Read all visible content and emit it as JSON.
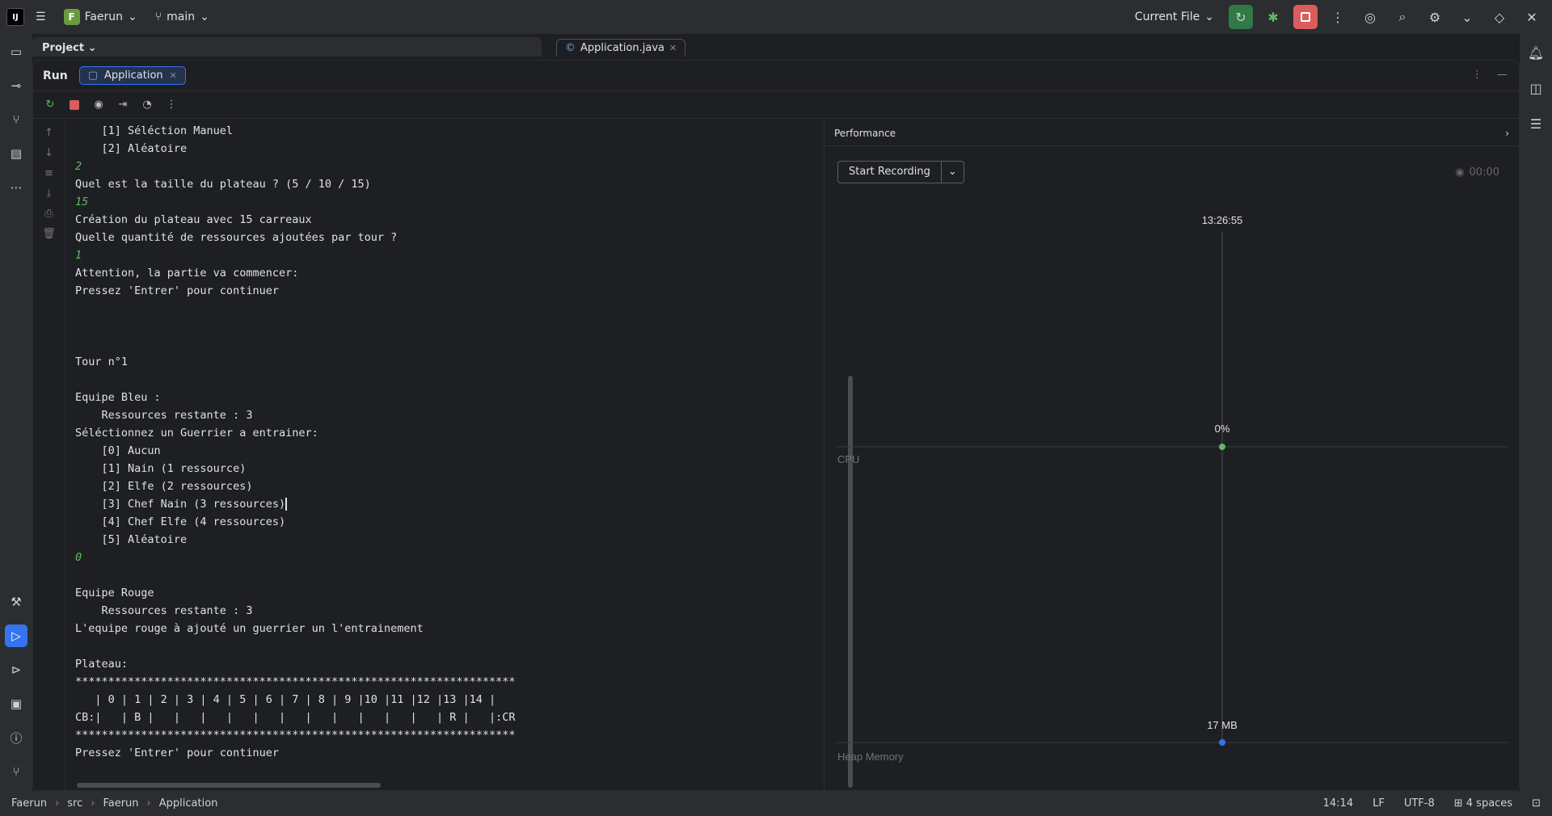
{
  "titlebar": {
    "logo": "IJ",
    "project_initial": "F",
    "project_name": "Faerun",
    "branch": "main",
    "run_config": "Current File"
  },
  "editor": {
    "project_label": "Project",
    "open_file": "Application.java"
  },
  "run": {
    "title": "Run",
    "tab_label": "Application"
  },
  "console": {
    "lines": [
      {
        "text": "    [1] Séléction Manuel",
        "input": false
      },
      {
        "text": "    [2] Aléatoire",
        "input": false
      },
      {
        "text": "2",
        "input": true
      },
      {
        "text": "Quel est la taille du plateau ? (5 / 10 / 15)",
        "input": false
      },
      {
        "text": "15",
        "input": true
      },
      {
        "text": "Création du plateau avec 15 carreaux",
        "input": false
      },
      {
        "text": "Quelle quantité de ressources ajoutées par tour ?",
        "input": false
      },
      {
        "text": "1",
        "input": true
      },
      {
        "text": "Attention, la partie va commencer:",
        "input": false
      },
      {
        "text": "Pressez 'Entrer' pour continuer",
        "input": false
      },
      {
        "text": "",
        "input": false
      },
      {
        "text": "",
        "input": false
      },
      {
        "text": "",
        "input": false
      },
      {
        "text": "Tour n°1",
        "input": false
      },
      {
        "text": "",
        "input": false
      },
      {
        "text": "Equipe Bleu :",
        "input": false
      },
      {
        "text": "    Ressources restante : 3",
        "input": false
      },
      {
        "text": "Séléctionnez un Guerrier a entrainer:",
        "input": false
      },
      {
        "text": "    [0] Aucun",
        "input": false
      },
      {
        "text": "    [1] Nain (1 ressource)",
        "input": false
      },
      {
        "text": "    [2] Elfe (2 ressources)",
        "input": false
      },
      {
        "text": "    [3] Chef Nain (3 ressources)",
        "input": false,
        "caret": true
      },
      {
        "text": "    [4] Chef Elfe (4 ressources)",
        "input": false
      },
      {
        "text": "    [5] Aléatoire",
        "input": false
      },
      {
        "text": "0",
        "input": true
      },
      {
        "text": "",
        "input": false
      },
      {
        "text": "Equipe Rouge",
        "input": false
      },
      {
        "text": "    Ressources restante : 3",
        "input": false
      },
      {
        "text": "L'equipe rouge à ajouté un guerrier un l'entrainement",
        "input": false
      },
      {
        "text": "",
        "input": false
      },
      {
        "text": "Plateau:",
        "input": false
      },
      {
        "text": "*******************************************************************",
        "input": false
      },
      {
        "text": "   | 0 | 1 | 2 | 3 | 4 | 5 | 6 | 7 | 8 | 9 |10 |11 |12 |13 |14 |",
        "input": false
      },
      {
        "text": "CB:|   | B |   |   |   |   |   |   |   |   |   |   |   | R |   |:CR",
        "input": false
      },
      {
        "text": "*******************************************************************",
        "input": false
      },
      {
        "text": "Pressez 'Entrer' pour continuer",
        "input": false
      }
    ]
  },
  "performance": {
    "title": "Performance",
    "record_label": "Start Recording",
    "timer": "00:00",
    "timestamp": "13:26:55",
    "cpu_value": "0%",
    "cpu_label": "CPU",
    "memory_value": "17 MB",
    "memory_label": "Heap Memory",
    "colors": {
      "cpu": "#5fb865",
      "memory": "#3574f0"
    }
  },
  "status": {
    "breadcrumbs": [
      "Faerun",
      "src",
      "Faerun",
      "Application"
    ],
    "position": "14:14",
    "line_sep": "LF",
    "encoding": "UTF-8",
    "indent": "4 spaces"
  }
}
